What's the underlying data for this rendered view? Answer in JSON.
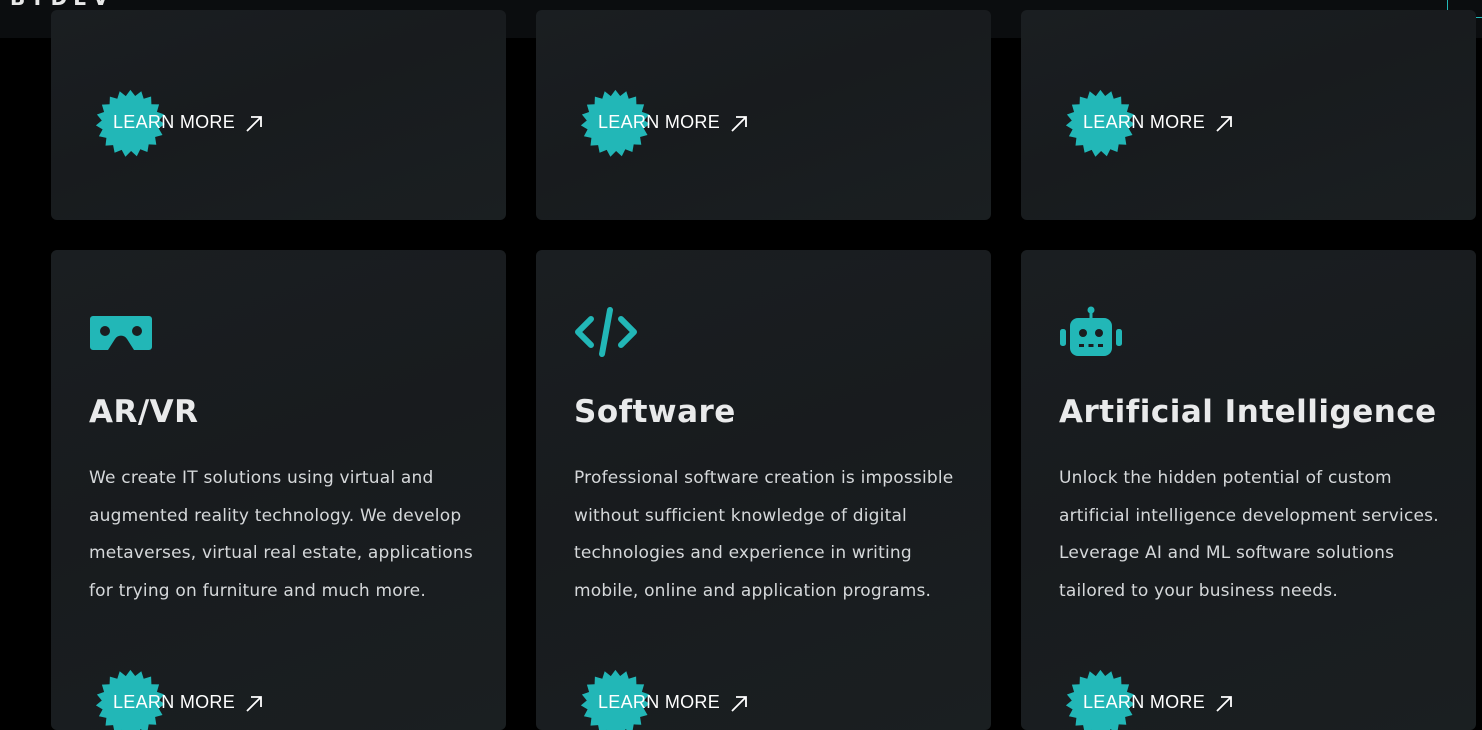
{
  "header": {
    "logo_fragment": "BYDEV"
  },
  "colors": {
    "accent": "#22b7b7",
    "background": "#000000",
    "card": "#1a1d20",
    "text": "#ffffff",
    "muted": "#d5d8da"
  },
  "cards_top": [
    {
      "learn_more": "LEARN MORE"
    },
    {
      "learn_more": "LEARN MORE"
    },
    {
      "learn_more": "LEARN MORE"
    }
  ],
  "cards": [
    {
      "icon": "vr-headset-icon",
      "title": "AR/VR",
      "description_lines": [
        "We create IT solutions using virtual and",
        "augmented reality technology. We develop",
        "metaverses, virtual real estate, applications",
        "for trying on furniture and much more."
      ],
      "learn_more": "LEARN MORE"
    },
    {
      "icon": "code-icon",
      "title": "Software",
      "description_lines": [
        "Professional software creation is impossible",
        "without sufficient knowledge of digital",
        "technologies and experience in writing",
        "mobile, online and application programs."
      ],
      "learn_more": "LEARN MORE"
    },
    {
      "icon": "robot-icon",
      "title": "Artificial Intelligence",
      "description_lines": [
        "Unlock the hidden potential of custom",
        "artificial intelligence development services.",
        "Leverage AI and ML software solutions",
        "tailored to your business needs."
      ],
      "learn_more": "LEARN MORE"
    }
  ]
}
